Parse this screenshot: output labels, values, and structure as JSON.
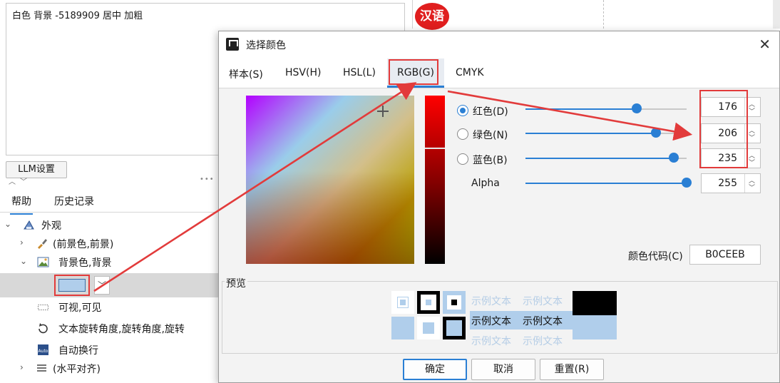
{
  "background": {
    "textarea_text": "白色 背景 -5189909 居中 加粗",
    "llm_button": "LLM设置",
    "hanyu_badge": "汉语",
    "left_tabs": [
      "帮助",
      "历史记录"
    ],
    "tree": [
      {
        "label": "外观",
        "expanded": true,
        "icon": "appearance-icon"
      },
      {
        "label": "(前景色,前景)",
        "expanded": false,
        "icon": "brush-icon"
      },
      {
        "label": "背景色,背景",
        "expanded": true,
        "icon": "image-icon"
      },
      {
        "label": "可视,可见",
        "icon": "dotted-rect-icon"
      },
      {
        "label": "文本旋转角度,旋转角度,旋转",
        "icon": "rotate-icon"
      },
      {
        "label": "自动换行",
        "icon": "auto-wrap-icon"
      },
      {
        "label": "(水平对齐)",
        "expanded": false,
        "icon": "align-icon"
      }
    ],
    "swatch_color": "#B0CEEB"
  },
  "dialog": {
    "title": "选择颜色",
    "tabs": [
      "样本(S)",
      "HSV(H)",
      "HSL(L)",
      "RGB(G)",
      "CMYK"
    ],
    "active_tab": "RGB(G)",
    "channels": [
      {
        "label": "红色(D)",
        "value": "176",
        "fraction": 0.69,
        "selected": true
      },
      {
        "label": "绿色(N)",
        "value": "206",
        "fraction": 0.81,
        "selected": false
      },
      {
        "label": "蓝色(B)",
        "value": "235",
        "fraction": 0.92,
        "selected": false
      },
      {
        "label": "Alpha",
        "value": "255",
        "fraction": 1.0,
        "selected": false
      }
    ],
    "hex_label": "颜色代码(C)",
    "hex_value": "B0CEEB",
    "preview_label": "预览",
    "sample_text": "示例文本",
    "buttons": {
      "ok": "确定",
      "cancel": "取消",
      "reset": "重置(R)"
    },
    "selected_color": "#B0CEEB",
    "accent_color": "#2A7FD4",
    "annotation_color": "#E23B3B"
  }
}
